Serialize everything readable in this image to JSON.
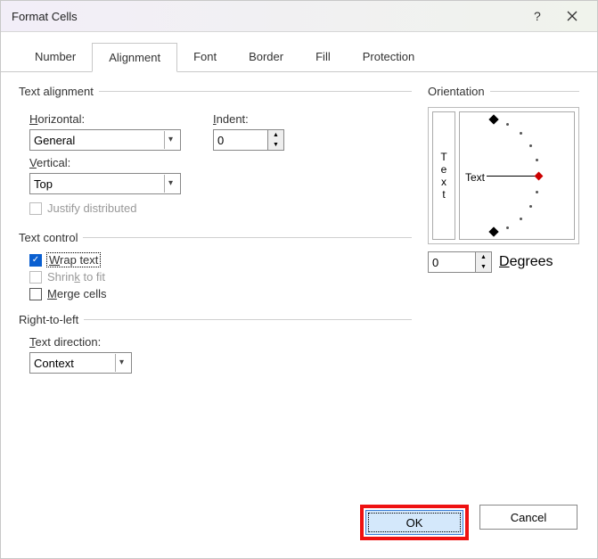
{
  "title": "Format Cells",
  "tabs": [
    "Number",
    "Alignment",
    "Font",
    "Border",
    "Fill",
    "Protection"
  ],
  "active_tab": 1,
  "text_alignment": {
    "group_label": "Text alignment",
    "horizontal_label": "Horizontal:",
    "horizontal_value": "General",
    "vertical_label": "Vertical:",
    "vertical_value": "Top",
    "indent_label": "Indent:",
    "indent_value": "0",
    "justify_label": "Justify distributed"
  },
  "text_control": {
    "group_label": "Text control",
    "wrap_label": "Wrap text",
    "wrap_checked": true,
    "shrink_label": "Shrink to fit",
    "merge_label": "Merge cells"
  },
  "rtl": {
    "group_label": "Right-to-left",
    "direction_label": "Text direction:",
    "direction_value": "Context"
  },
  "orientation": {
    "group_label": "Orientation",
    "vertical_text": [
      "T",
      "e",
      "x",
      "t"
    ],
    "arc_text": "Text",
    "degrees_value": "0",
    "degrees_label": "Degrees"
  },
  "footer": {
    "ok": "OK",
    "cancel": "Cancel"
  }
}
